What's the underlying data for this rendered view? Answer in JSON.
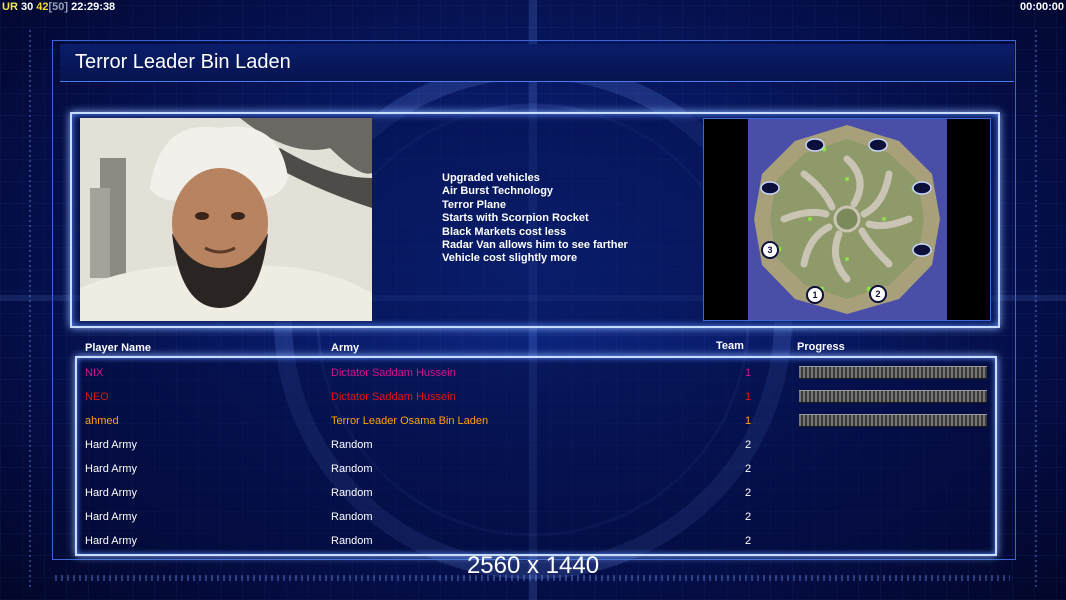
{
  "hud": {
    "ur_label": "UR",
    "val1": "30",
    "val2": "42",
    "bracket_val": "[50]",
    "clock": "22:29:38",
    "timer": "00:00:00"
  },
  "title": "Terror Leader Bin Laden",
  "features": [
    "Upgraded vehicles",
    "Air Burst Technology",
    "Terror Plane",
    "Starts with Scorpion Rocket",
    "Black Markets cost less",
    "Radar Van allows him to see farther",
    "Vehicle cost slightly more"
  ],
  "map": {
    "markers": [
      "1",
      "2",
      "3"
    ]
  },
  "columns": {
    "name": "Player Name",
    "army": "Army",
    "team": "Team",
    "progress": "Progress"
  },
  "players": [
    {
      "name": "NIX",
      "army": "Dictator Saddam Hussein",
      "team": "1",
      "color": "#d0168a",
      "progress": 1.0
    },
    {
      "name": "NEO",
      "army": "Dictator Saddam Hussein",
      "team": "1",
      "color": "#e41616",
      "progress": 1.0
    },
    {
      "name": "ahmed",
      "army": "Terror Leader Osama Bin Laden",
      "team": "1",
      "color": "#ffa20e",
      "progress": 1.0
    },
    {
      "name": "Hard Army",
      "army": "Random",
      "team": "2",
      "color": "#ffffff"
    },
    {
      "name": "Hard Army",
      "army": "Random",
      "team": "2",
      "color": "#ffffff"
    },
    {
      "name": "Hard Army",
      "army": "Random",
      "team": "2",
      "color": "#ffffff"
    },
    {
      "name": "Hard Army",
      "army": "Random",
      "team": "2",
      "color": "#ffffff"
    },
    {
      "name": "Hard Army",
      "army": "Random",
      "team": "2",
      "color": "#ffffff"
    }
  ],
  "resolution": "2560 x 1440"
}
